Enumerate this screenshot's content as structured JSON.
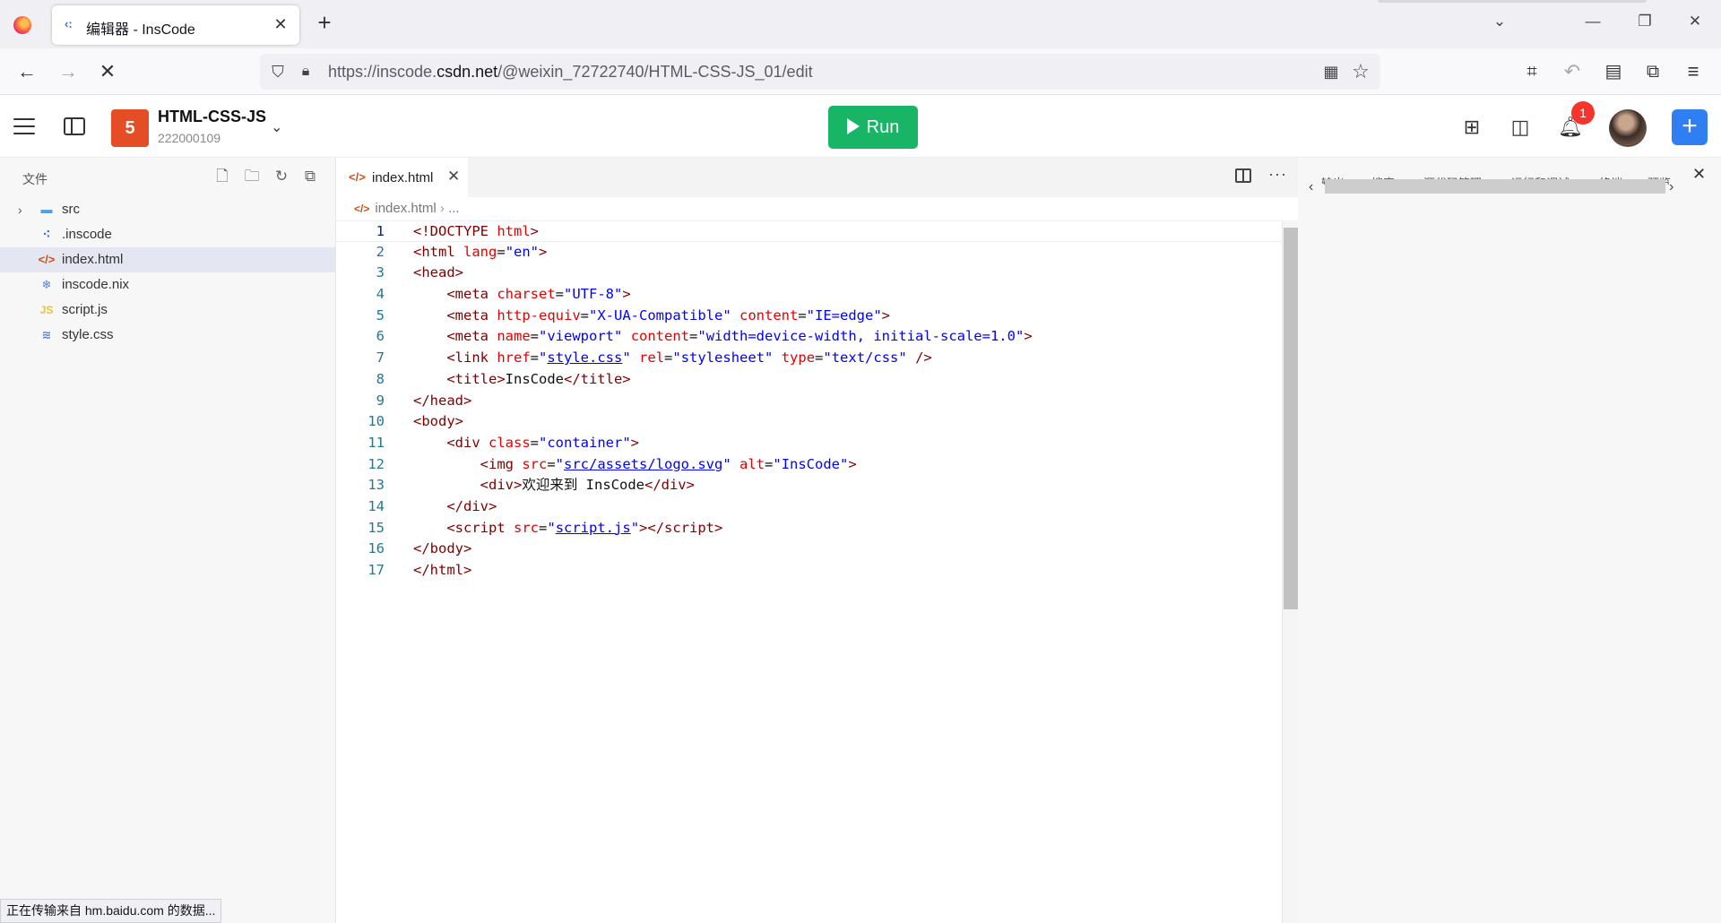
{
  "browser": {
    "tab_title": "编辑器 - InsCode",
    "url_prefix": "https://inscode.",
    "url_domain": "csdn.net",
    "url_path": "/@weixin_72722740/HTML-CSS-JS_01/edit"
  },
  "header": {
    "project_name": "HTML-CSS-JS",
    "project_id": "222000109",
    "run_label": "Run",
    "notification_count": "1",
    "project_logo_text": "5"
  },
  "explorer": {
    "title": "文件",
    "items": [
      {
        "name": "src"
      },
      {
        "name": ".inscode"
      },
      {
        "name": "index.html"
      },
      {
        "name": "inscode.nix"
      },
      {
        "name": "script.js"
      },
      {
        "name": "style.css"
      }
    ],
    "status": "正在传输来自 hm.baidu.com 的数据..."
  },
  "editor": {
    "tab_label": "index.html",
    "breadcrumb_file": "index.html",
    "breadcrumb_more": "...",
    "line_numbers": [
      "1",
      "2",
      "3",
      "4",
      "5",
      "6",
      "7",
      "8",
      "9",
      "10",
      "11",
      "12",
      "13",
      "14",
      "15",
      "16",
      "17"
    ]
  },
  "right_panel": {
    "tabs": [
      "输出",
      "搜索",
      "源代码管理",
      "运行和调试",
      "终端",
      "预览"
    ]
  },
  "colors": {
    "run": "#18b566",
    "accent": "#2f7ff2",
    "badge": "#f5342b",
    "html_orange": "#e44d26"
  }
}
